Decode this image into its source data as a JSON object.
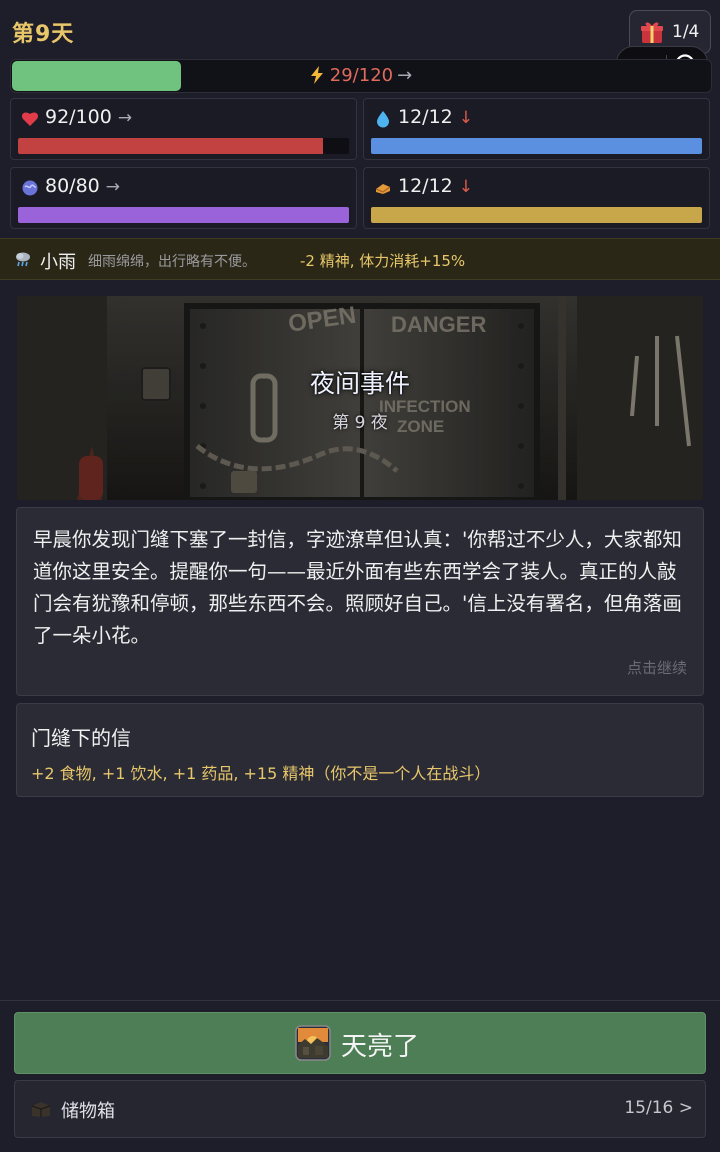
{
  "header": {
    "day_label": "第9天",
    "gift_count": "1/4"
  },
  "energy": {
    "value": 29,
    "max": 120,
    "label": "29/120",
    "arrow": "→",
    "fill_color": "#6fc37f"
  },
  "stats": [
    {
      "id": "health",
      "icon": "heart-icon",
      "label": "92/100",
      "arrow": "→",
      "arrow_color": "#a9a9b5",
      "value": 92,
      "max": 100,
      "color": "#c24141"
    },
    {
      "id": "water",
      "icon": "water-drop-icon",
      "label": "12/12",
      "arrow": "↓",
      "arrow_color": "#e05a4a",
      "value": 12,
      "max": 12,
      "color": "#5b8fe0"
    },
    {
      "id": "sanity",
      "icon": "brain-icon",
      "label": "80/80",
      "arrow": "→",
      "arrow_color": "#a9a9b5",
      "value": 80,
      "max": 80,
      "color": "#9b63d9"
    },
    {
      "id": "food",
      "icon": "bread-icon",
      "label": "12/12",
      "arrow": "↓",
      "arrow_color": "#e05a4a",
      "value": 12,
      "max": 12,
      "color": "#c8a74a"
    }
  ],
  "weather": {
    "icon": "rain-cloud-icon",
    "name": "小雨",
    "description": "细雨绵绵，出行略有不便。",
    "effect": "-2 精神, 体力消耗+15%"
  },
  "event": {
    "title": "夜间事件",
    "subtitle": "第 9 夜",
    "banner_signs": [
      "OPEN",
      "DANGER",
      "INFECTION",
      "ZONE"
    ],
    "story": "早晨你发现门缝下塞了一封信，字迹潦草但认真：'你帮过不少人，大家都知道你这里安全。提醒你一句——最近外面有些东西学会了装人。真正的人敲门会有犹豫和停顿，那些东西不会。照顾好自己。'信上没有署名，但角落画了一朵小花。",
    "continue_hint": "点击继续"
  },
  "result": {
    "title": "门缝下的信",
    "rewards": "+2 食物, +1 饮水, +1 药品, +15 精神（你不是一个人在战斗）"
  },
  "actions": {
    "dawn_label": "天亮了",
    "storage_label": "储物箱",
    "storage_count": "15/16",
    "storage_arrow": ">"
  }
}
